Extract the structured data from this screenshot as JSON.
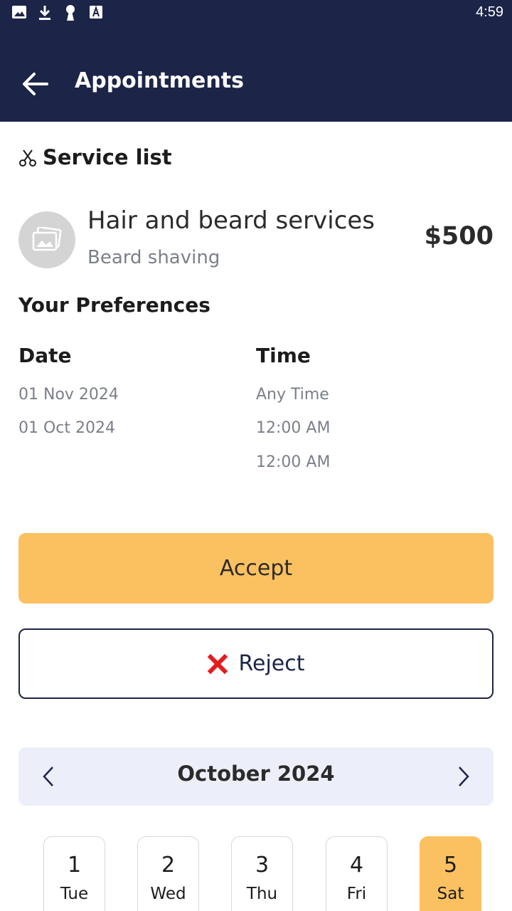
{
  "status_bar": {
    "time": "4:59",
    "icons": [
      "image-icon",
      "download-icon",
      "keyhole-icon",
      "font-icon"
    ]
  },
  "header": {
    "title": "Appointments",
    "back_icon": "arrow-left-icon"
  },
  "service_section": {
    "title": "Service list",
    "icon": "scissors-icon"
  },
  "service": {
    "name": "Hair and beard services",
    "subtitle": "Beard shaving",
    "price": "$500",
    "thumbnail_icon": "image-placeholder-icon"
  },
  "preferences": {
    "title": "Your Preferences",
    "date_header": "Date",
    "time_header": "Time",
    "dates": [
      "01 Nov 2024",
      "01 Oct 2024"
    ],
    "times": [
      "Any Time",
      "12:00 AM",
      "12:00 AM"
    ]
  },
  "actions": {
    "accept_label": "Accept",
    "reject_label": "Reject",
    "reject_icon": "close-x-icon"
  },
  "calendar": {
    "month_label": "October 2024",
    "prev_icon": "chevron-left-icon",
    "next_icon": "chevron-right-icon",
    "days": [
      {
        "num": "1",
        "weekday": "Tue"
      },
      {
        "num": "2",
        "weekday": "Wed"
      },
      {
        "num": "3",
        "weekday": "Thu"
      },
      {
        "num": "4",
        "weekday": "Fri"
      },
      {
        "num": "5",
        "weekday": "Sat"
      }
    ],
    "selected_index": 4
  },
  "colors": {
    "header_bg": "#1c2548",
    "accent": "#fbc160",
    "calendar_bg": "#eceef9",
    "reject_x": "#e21d1d"
  }
}
